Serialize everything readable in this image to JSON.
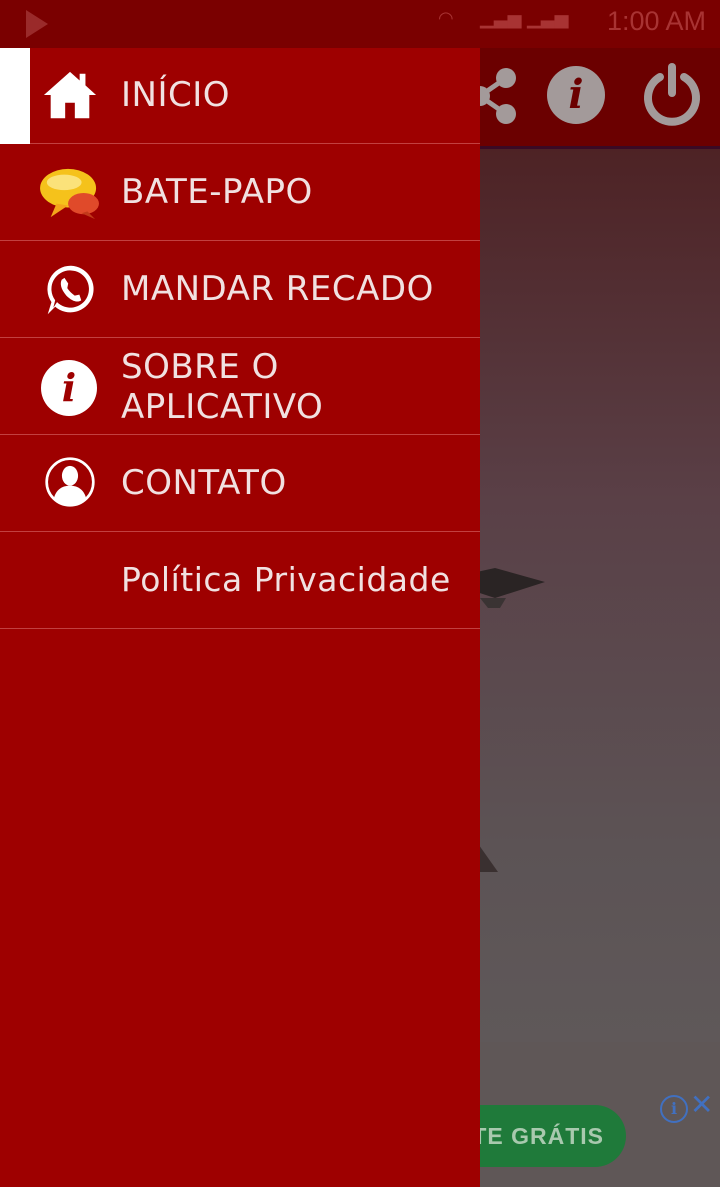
{
  "status_bar": {
    "time": "1:00 AM"
  },
  "ad": {
    "button_label": "TE GRÁTIS",
    "info_symbol": "i",
    "close_symbol": "✕"
  },
  "toolbar": {
    "info_symbol": "i"
  },
  "drawer": {
    "items": [
      {
        "label": "INÍCIO",
        "icon": "home-icon"
      },
      {
        "label": "BATE-PAPO",
        "icon": "chat-bubble-icon"
      },
      {
        "label": "MANDAR RECADO",
        "icon": "whatsapp-icon"
      },
      {
        "label_line1": "SOBRE O",
        "label_line2": "APLICATIVO",
        "icon": "info-icon"
      },
      {
        "label": "CONTATO",
        "icon": "contact-icon"
      },
      {
        "label": "Política Privacidade"
      }
    ]
  }
}
